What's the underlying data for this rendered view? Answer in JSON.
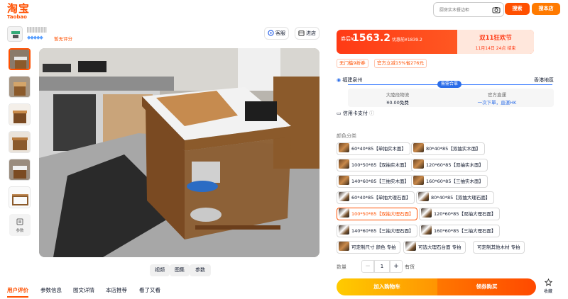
{
  "header": {
    "logo_cn": "淘宝",
    "logo_en": "Taobao",
    "search_placeholder": "厨房实木餐边柜",
    "search_button": "搜索",
    "search_store_button": "搜本店"
  },
  "shop": {
    "badge": "◆◆◆◆◆",
    "no_review": "暂无评分",
    "service_button": "客服",
    "enter_button": "进店"
  },
  "thumbnails": [
    "thumb-1",
    "thumb-2",
    "thumb-3",
    "thumb-4",
    "thumb-5",
    "thumb-6"
  ],
  "params_thumb_label": "参数",
  "media_tabs": [
    "视频",
    "图集",
    "参数"
  ],
  "bottom_nav": [
    "用户评价",
    "参数信息",
    "图文详情",
    "本店推荐",
    "看了又看"
  ],
  "price": {
    "prefix": "券后¥",
    "value": "1563.2",
    "original": "优惠前¥1839.2",
    "festival": "双11狂欢节",
    "ends": "11月14日 24点 结束"
  },
  "tags": [
    "无门槛9折券",
    "官方立减15%省276元"
  ],
  "shipping": {
    "from": "福建泉州",
    "to": "香港地區",
    "route_label": "無需合單",
    "logistics_title": "大陸段物流",
    "logistics_value": "¥0.00免费",
    "direct_title": "官方直運",
    "direct_value": "一次下單，直運HK"
  },
  "credit": "信用卡支付",
  "color_label": "颜色分类",
  "options": [
    "60*40*85【单抽实木面】",
    "80*40*85【双抽实木面】",
    "100*50*85【双抽实木面】",
    "120*60*85【双抽实木面】",
    "140*60*85【三抽实木面】",
    "160*60*85【三抽实木面】",
    "60*40*85【单抽大理石面】",
    "80*40*85【双抽大理石面】",
    "100*50*85【双抽大理石面】",
    "120*60*85【双抽大理石面】",
    "140*60*85【三抽大理石面】",
    "160*60*85【三抽大理石面】",
    "可定制尺寸 颜色 专拍",
    "可选大理石台面 专拍",
    "可定制其他木材 专拍"
  ],
  "selected_option": "100*50*85【双抽大理石面】",
  "quantity": {
    "label": "数量",
    "value": "1",
    "stock": "有货",
    "minus": "−",
    "plus": "+"
  },
  "actions": {
    "add_to_cart": "加入购物车",
    "buy_now": "领券购买",
    "favorite": "收藏"
  },
  "colors": {
    "accent": "#ff5000",
    "link_blue": "#2b6de8"
  }
}
